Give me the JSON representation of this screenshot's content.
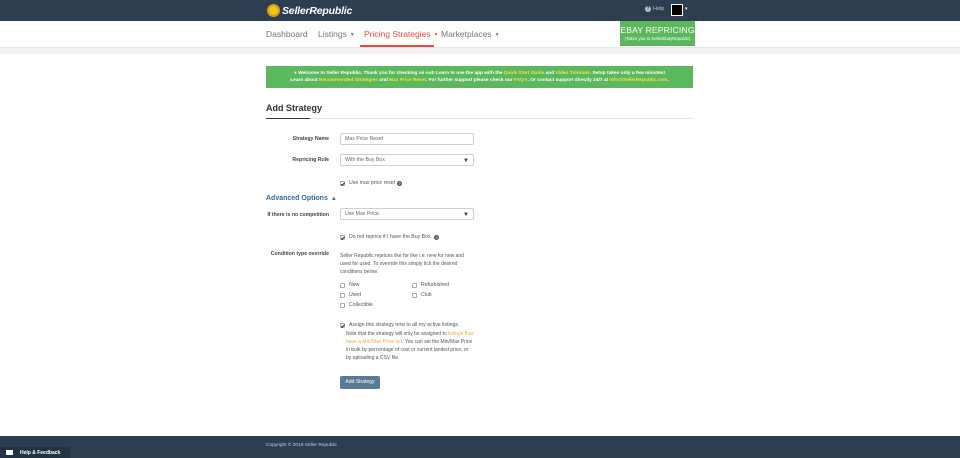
{
  "app": {
    "brand": "SellerRepublic",
    "help_label": "Help"
  },
  "nav": {
    "items": [
      {
        "label": "Dashboard"
      },
      {
        "label": "Listings"
      },
      {
        "label": "Pricing Strategies"
      },
      {
        "label": "Marketplaces"
      }
    ],
    "active": "Pricing Strategies"
  },
  "ebay": {
    "title": "EBAY REPRICING",
    "subtitle": "(Takes you to SellerEbayRepublic)"
  },
  "alert": {
    "p1": "Welcome to Seller Republic. Thank you for checking us out! Learn to use the app with the ",
    "link1": "Quick Start Guide",
    "p2": " and ",
    "link2": "Video Tutorials",
    "p3": ". Setup takes only a few minutes!",
    "p4": "Learn about ",
    "link3": "Recommended Strategies",
    "p5": " and ",
    "link4": "Max Price Reset",
    "p6": ". For further support please check our ",
    "link5": "FAQ's",
    "p7": ". Or contact support directly 24/7 at ",
    "link6": "info@SellerRepublic.com",
    "p8": "."
  },
  "page": {
    "title": "Add Strategy"
  },
  "form": {
    "strategy_name_label": "Strategy Name",
    "strategy_name_value": "Max Price Reset",
    "repricing_rule_label": "Repricing Rule",
    "repricing_rule_value": "With the Buy Box",
    "use_max_price_reset_label": "Use max price reset",
    "advanced_options_label": "Advanced Options",
    "no_competition_label": "If there is no competition",
    "no_competition_value": "Use Max Price.",
    "no_reprice_buybox_label": "Do not reprice if I have the Buy Box.",
    "condition_override_label": "Condition type override",
    "condition_override_text": "Seller Republic reprices like for like i.e. new for new and used for used. To override this simply tick the desired conditions below.",
    "conditions": [
      {
        "label": "New"
      },
      {
        "label": "Refurbished"
      },
      {
        "label": "Used"
      },
      {
        "label": "Club"
      },
      {
        "label": "Collectible"
      }
    ],
    "assign_label": "Assign this strategy now to all my active listings.",
    "assign_note_1": "Note that the strategy will only be assigned to ",
    "assign_note_link1": "listings that have a Min/Max Price set",
    "assign_note_2": ". You can set the Min/Max Price in bulk by ",
    "assign_note_link2": "percentage of cost",
    "assign_note_3": " or ",
    "assign_note_link3": "current landed price",
    "assign_note_4": ", or by ",
    "assign_note_link4": "uploading a CSV file",
    "assign_note_5": ".",
    "submit_label": "Add Strategy"
  },
  "footer": {
    "copyright": "Copyright © 2019 Seller Republic",
    "feedback": "Help & Feedback"
  }
}
